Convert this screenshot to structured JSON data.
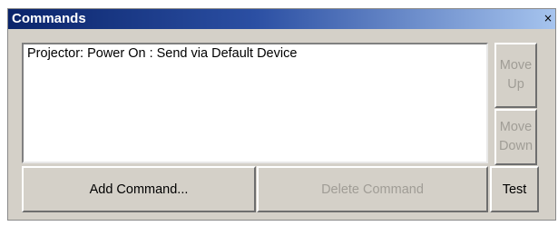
{
  "window": {
    "title": "Commands",
    "close_glyph": "×"
  },
  "commands": {
    "items": [
      {
        "text": "Projector: Power On : Send via Default Device"
      }
    ]
  },
  "buttons": {
    "move_up": {
      "line1": "Move",
      "line2": "Up",
      "enabled": false
    },
    "move_down": {
      "line1": "Move",
      "line2": "Down",
      "enabled": false
    },
    "add_command": {
      "label": "Add Command...",
      "enabled": true
    },
    "delete_command": {
      "label": "Delete Command",
      "enabled": false
    },
    "test": {
      "label": "Test",
      "enabled": true
    }
  },
  "colors": {
    "title_start": "#0a246a",
    "title_end": "#a6c4ee",
    "face": "#d4d0c8",
    "disabled_text": "#a09d96"
  }
}
